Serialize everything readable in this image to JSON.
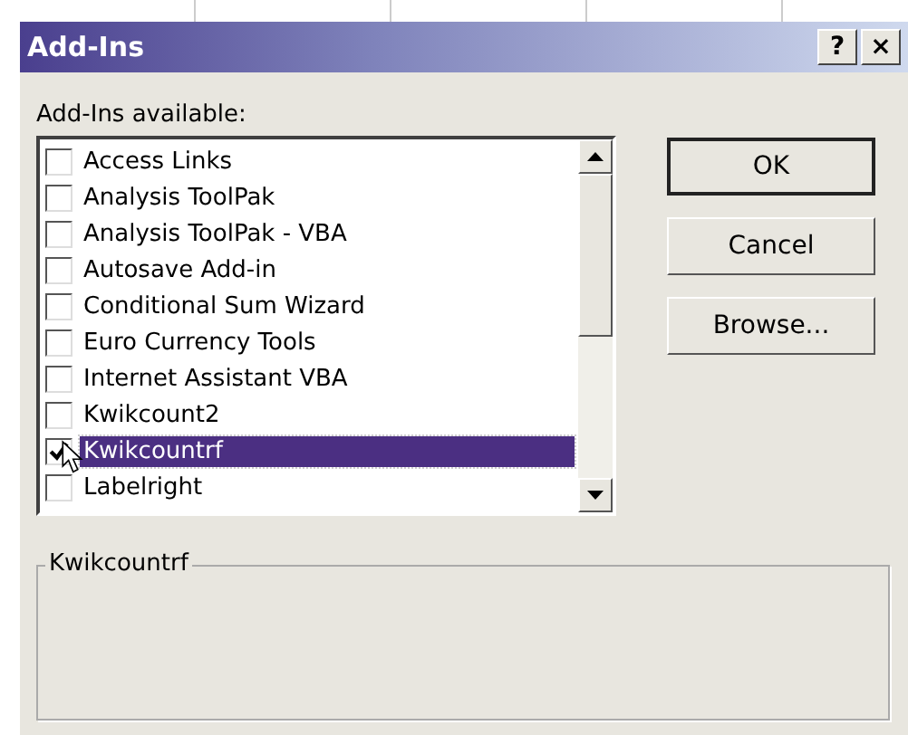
{
  "window": {
    "title": "Add-Ins",
    "help_button": "?",
    "close_button": "×"
  },
  "list_label": "Add-Ins available:",
  "addins": [
    {
      "name": "Access Links",
      "checked": false,
      "selected": false
    },
    {
      "name": "Analysis ToolPak",
      "checked": false,
      "selected": false
    },
    {
      "name": "Analysis ToolPak - VBA",
      "checked": false,
      "selected": false
    },
    {
      "name": "Autosave Add-in",
      "checked": false,
      "selected": false
    },
    {
      "name": "Conditional Sum Wizard",
      "checked": false,
      "selected": false
    },
    {
      "name": "Euro Currency Tools",
      "checked": false,
      "selected": false
    },
    {
      "name": "Internet Assistant VBA",
      "checked": false,
      "selected": false
    },
    {
      "name": "Kwikcount2",
      "checked": false,
      "selected": false
    },
    {
      "name": "Kwikcountrf",
      "checked": true,
      "selected": true
    },
    {
      "name": "Labelright",
      "checked": false,
      "selected": false
    }
  ],
  "buttons": [
    {
      "label": "OK",
      "default": true
    },
    {
      "label": "Cancel",
      "default": false
    },
    {
      "label": "Browse...",
      "default": false
    }
  ],
  "description": {
    "title": "Kwikcountrf"
  }
}
